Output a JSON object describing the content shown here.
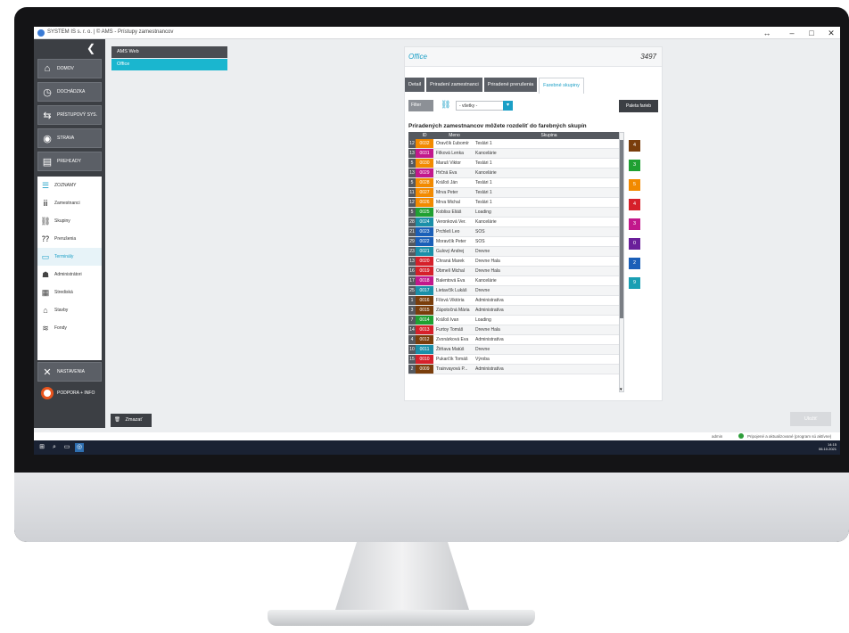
{
  "window": {
    "title": "SYSTEM IS s. r. o. | © AMS - Prístupy zamestnancov",
    "btn_restore": "↔",
    "btn_minimize": "–",
    "btn_maximize": "□",
    "btn_close": "✕"
  },
  "sidebar": {
    "collapse_glyph": "❮",
    "nav": [
      {
        "label": "DOMOV",
        "icon": "home-icon",
        "glyph": "⌂"
      },
      {
        "label": "DOCHÁDZKA",
        "icon": "clock-icon",
        "glyph": "◷"
      },
      {
        "label": "PRÍSTUPOVÝ SYS.",
        "icon": "access-icon",
        "glyph": "⇆"
      },
      {
        "label": "STRAVA",
        "icon": "food-icon",
        "glyph": "◉"
      },
      {
        "label": "PREHĽADY",
        "icon": "reports-icon",
        "glyph": "▤"
      }
    ],
    "sub": [
      {
        "label": "ZOZNAMY",
        "icon": "list-icon",
        "glyph": "☰"
      },
      {
        "label": "Zamestnanci",
        "icon": "employees-icon",
        "glyph": "ⅲ"
      },
      {
        "label": "Skupiny",
        "icon": "groups-icon",
        "glyph": "⛓"
      },
      {
        "label": "Prerušenia",
        "icon": "breaks-icon",
        "glyph": "⁇"
      },
      {
        "label": "Terminály",
        "icon": "terminal-icon",
        "glyph": "▭"
      },
      {
        "label": "Administrátori",
        "icon": "admin-icon",
        "glyph": "☗"
      },
      {
        "label": "Strediská",
        "icon": "centers-icon",
        "glyph": "▦"
      },
      {
        "label": "Stavby",
        "icon": "buildings-icon",
        "glyph": "⌂"
      },
      {
        "label": "Fondy",
        "icon": "funds-icon",
        "glyph": "≋"
      }
    ],
    "settings": {
      "label": "NASTAVENIA",
      "icon": "tools-icon",
      "glyph": "✕"
    },
    "support": {
      "label": "PODPORA + INFO",
      "icon": "lifebuoy-icon"
    }
  },
  "tree": {
    "items": [
      {
        "label": "AMS Web",
        "color": "#4a4d52"
      },
      {
        "label": "Office",
        "color": "#1ab6cf"
      }
    ]
  },
  "main": {
    "office_title": "Office",
    "office_count": "3497",
    "tabs": [
      "Detail",
      "Priradení zamestnanci",
      "Priradené prerušenia",
      "Farebné skupiny"
    ],
    "filter_label": "Filter",
    "select_value": "- všetky -",
    "select_arrow": "▾",
    "palette_label": "Paleta farieb",
    "heading": "Priradených zamestnancov môžete rozdeliť do farebných skupín",
    "columns": [
      "ID",
      "Meno",
      "Skupina"
    ],
    "rows": [
      {
        "idx": "12",
        "id": "0032",
        "name": "Oravčík Ľubomír",
        "group": "Teslári 1",
        "color": "#f28a00"
      },
      {
        "idx": "13",
        "id": "0031",
        "name": "Filková Lenka",
        "group": "Kancelárie",
        "color": "#c2188c"
      },
      {
        "idx": "5",
        "id": "0030",
        "name": "Maruš Viktor",
        "group": "Teslári 1",
        "color": "#f28a00"
      },
      {
        "idx": "13",
        "id": "0029",
        "name": "Hrčná Eva",
        "group": "Kancelárie",
        "color": "#c2188c"
      },
      {
        "idx": "5",
        "id": "0028",
        "name": "Kráľoš Ján",
        "group": "Teslári 1",
        "color": "#f28a00"
      },
      {
        "idx": "11",
        "id": "0027",
        "name": "Mrva Peter",
        "group": "Teslári 1",
        "color": "#f28a00"
      },
      {
        "idx": "12",
        "id": "0026",
        "name": "Mrva Michal",
        "group": "Teslári 1",
        "color": "#f28a00"
      },
      {
        "idx": "5",
        "id": "0025",
        "name": "Kobliss Eliáš",
        "group": "Loading",
        "color": "#1fa032"
      },
      {
        "idx": "28",
        "id": "0024",
        "name": "Veronková Ver.",
        "group": "Kancelárie",
        "color": "#1a8fa8"
      },
      {
        "idx": "21",
        "id": "0023",
        "name": "Prchleš Leo",
        "group": "SOS",
        "color": "#1a5fb8"
      },
      {
        "idx": "29",
        "id": "0022",
        "name": "Moravčík Peter",
        "group": "SOS",
        "color": "#1a5fb8"
      },
      {
        "idx": "23",
        "id": "0021",
        "name": "Gulový Andrej",
        "group": "Drevne",
        "color": "#1a8fa8"
      },
      {
        "idx": "13",
        "id": "0020",
        "name": "Chraná Marek",
        "group": "Drevne Hala",
        "color": "#d6202a"
      },
      {
        "idx": "16",
        "id": "0019",
        "name": "Obmelí Michal",
        "group": "Drevne Hala",
        "color": "#d6202a"
      },
      {
        "idx": "17",
        "id": "0018",
        "name": "Balentová Eva",
        "group": "Kancelárie",
        "color": "#c2188c"
      },
      {
        "idx": "25",
        "id": "0017",
        "name": "Lietavčík Lukáš",
        "group": "Drevne",
        "color": "#1a8fa8"
      },
      {
        "idx": "1",
        "id": "0016",
        "name": "Fílová Viktória",
        "group": "Administratíva",
        "color": "#7a3e0c"
      },
      {
        "idx": "3",
        "id": "0015",
        "name": "Zápotočná Mária",
        "group": "Administratíva",
        "color": "#7a3e0c"
      },
      {
        "idx": "7",
        "id": "0014",
        "name": "Kráľoš Ivan",
        "group": "Loading",
        "color": "#1fa032"
      },
      {
        "idx": "14",
        "id": "0013",
        "name": "Furtoy Tomáš",
        "group": "Drevne Hala",
        "color": "#d6202a"
      },
      {
        "idx": "4",
        "id": "0012",
        "name": "Zvonárková Eva",
        "group": "Administratíva",
        "color": "#7a3e0c"
      },
      {
        "idx": "10",
        "id": "0011",
        "name": "Žitňava Matúš",
        "group": "Drevne",
        "color": "#1a8fa8"
      },
      {
        "idx": "15",
        "id": "0010",
        "name": "Pukarčík Tomáš",
        "group": "Výroba",
        "color": "#d6202a"
      },
      {
        "idx": "2",
        "id": "0009",
        "name": "Trainvayová P...",
        "group": "Administratíva",
        "color": "#7a3e0c"
      }
    ],
    "scroll_down": "▾",
    "color_squares": [
      {
        "label": "4",
        "color": "#7a3e0c"
      },
      {
        "label": "3",
        "color": "#1fa032"
      },
      {
        "label": "5",
        "color": "#f28a00"
      },
      {
        "label": "4",
        "color": "#d6202a"
      },
      {
        "label": "3",
        "color": "#c2188c"
      },
      {
        "label": "0",
        "color": "#6a1f9a"
      },
      {
        "label": "2",
        "color": "#1a5fb8"
      },
      {
        "label": "9",
        "color": "#1a9fb3"
      }
    ]
  },
  "footer": {
    "delete_label": "Zmazať",
    "save_label": "Uložiť",
    "status_user": "admin",
    "status_text": "Pripojené a aktualizované (program sú aktívne)",
    "clock_time": "14:15",
    "clock_date": "06.10.2021"
  }
}
